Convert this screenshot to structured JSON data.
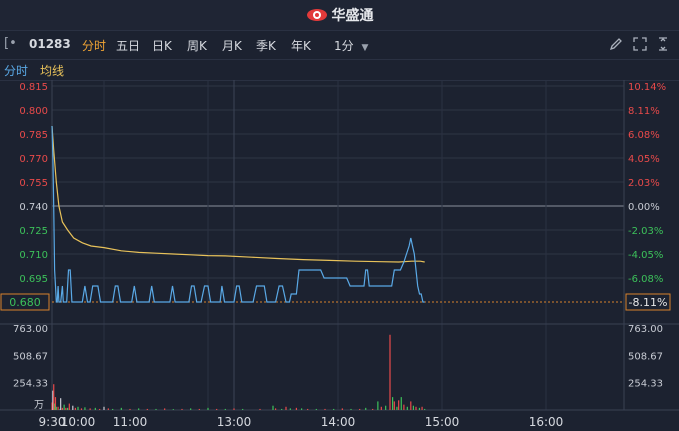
{
  "app": {
    "brand": "华盛通"
  },
  "toolbar": {
    "stock_code": "01283",
    "tabs": [
      {
        "label": "分时",
        "active": true
      },
      {
        "label": "五日",
        "active": false
      },
      {
        "label": "日K",
        "active": false
      },
      {
        "label": "周K",
        "active": false
      },
      {
        "label": "月K",
        "active": false
      },
      {
        "label": "季K",
        "active": false
      },
      {
        "label": "年K",
        "active": false
      }
    ],
    "interval": "1分"
  },
  "legend": {
    "price": "分时",
    "avg": "均线"
  },
  "colors": {
    "price_line": "#5aa9e6",
    "avg_line": "#e8c25a",
    "up": "#e84a4a",
    "down": "#3cc15a",
    "neutral": "#c8ccd4",
    "background": "#1c2230"
  },
  "chart_data": [
    {
      "type": "line",
      "name": "intraday",
      "y_left_labels": [
        "0.815",
        "0.800",
        "0.785",
        "0.770",
        "0.755",
        "0.740",
        "0.725",
        "0.710",
        "0.695"
      ],
      "y_right_labels": [
        "10.14%",
        "8.11%",
        "6.08%",
        "4.05%",
        "2.03%",
        "0.00%",
        "-2.03%",
        "-4.05%",
        "-6.08%"
      ],
      "ylim": [
        0.68,
        0.815
      ],
      "prev_close": 0.74,
      "current_price": "0.680",
      "current_change": "-8.11%",
      "x_labels": [
        "9:30",
        "10:00",
        "11:00",
        "13:00",
        "14:00",
        "15:00",
        "16:00"
      ],
      "series": [
        {
          "name": "分时",
          "values": [
            [
              0,
              0.79
            ],
            [
              1,
              0.77
            ],
            [
              2,
              0.74
            ],
            [
              3,
              0.7
            ],
            [
              4,
              0.69
            ],
            [
              5,
              0.68
            ],
            [
              6,
              0.68
            ],
            [
              7,
              0.69
            ],
            [
              8,
              0.68
            ],
            [
              10,
              0.68
            ],
            [
              12,
              0.69
            ],
            [
              13,
              0.68
            ],
            [
              15,
              0.68
            ],
            [
              17,
              0.68
            ],
            [
              19,
              0.7
            ],
            [
              21,
              0.7
            ],
            [
              23,
              0.68
            ],
            [
              25,
              0.68
            ],
            [
              30,
              0.68
            ],
            [
              35,
              0.68
            ],
            [
              38,
              0.69
            ],
            [
              41,
              0.68
            ],
            [
              44,
              0.68
            ],
            [
              47,
              0.69
            ],
            [
              50,
              0.69
            ],
            [
              53,
              0.69
            ],
            [
              56,
              0.68
            ],
            [
              60,
              0.68
            ],
            [
              65,
              0.68
            ],
            [
              70,
              0.68
            ],
            [
              73,
              0.69
            ],
            [
              76,
              0.69
            ],
            [
              79,
              0.68
            ],
            [
              85,
              0.68
            ],
            [
              92,
              0.68
            ],
            [
              95,
              0.69
            ],
            [
              98,
              0.68
            ],
            [
              105,
              0.68
            ],
            [
              112,
              0.68
            ],
            [
              115,
              0.69
            ],
            [
              118,
              0.68
            ],
            [
              125,
              0.68
            ],
            [
              130,
              0.68
            ],
            [
              136,
              0.68
            ],
            [
              139,
              0.69
            ],
            [
              142,
              0.68
            ],
            [
              150,
              0.68
            ],
            [
              158,
              0.68
            ],
            [
              161,
              0.69
            ],
            [
              164,
              0.69
            ],
            [
              167,
              0.68
            ],
            [
              172,
              0.68
            ],
            [
              176,
              0.69
            ],
            [
              180,
              0.69
            ],
            [
              183,
              0.68
            ],
            [
              188,
              0.68
            ],
            [
              194,
              0.68
            ],
            [
              196,
              0.69
            ],
            [
              199,
              0.68
            ],
            [
              205,
              0.68
            ],
            [
              210,
              0.68
            ],
            [
              213,
              0.69
            ],
            [
              216,
              0.69
            ],
            [
              219,
              0.68
            ],
            [
              225,
              0.68
            ],
            [
              232,
              0.68
            ],
            [
              236,
              0.69
            ],
            [
              240,
              0.69
            ],
            [
              245,
              0.69
            ],
            [
              248,
              0.68
            ],
            [
              252,
              0.68
            ],
            [
              258,
              0.68
            ],
            [
              262,
              0.69
            ],
            [
              266,
              0.69
            ],
            [
              270,
              0.68
            ],
            [
              274,
              0.68
            ],
            [
              276,
              0.685
            ],
            [
              279,
              0.685
            ],
            [
              282,
              0.685
            ],
            [
              285,
              0.7
            ],
            [
              290,
              0.7
            ],
            [
              295,
              0.7
            ],
            [
              300,
              0.7
            ],
            [
              305,
              0.7
            ],
            [
              310,
              0.7
            ],
            [
              314,
              0.695
            ],
            [
              320,
              0.695
            ],
            [
              325,
              0.695
            ],
            [
              330,
              0.695
            ],
            [
              335,
              0.695
            ],
            [
              340,
              0.695
            ],
            [
              344,
              0.69
            ],
            [
              348,
              0.69
            ],
            [
              352,
              0.69
            ],
            [
              356,
              0.69
            ],
            [
              360,
              0.69
            ],
            [
              362,
              0.7
            ],
            [
              364,
              0.7
            ],
            [
              366,
              0.69
            ],
            [
              372,
              0.69
            ],
            [
              378,
              0.69
            ],
            [
              384,
              0.69
            ],
            [
              388,
              0.69
            ],
            [
              392,
              0.69
            ],
            [
              395,
              0.7
            ],
            [
              398,
              0.7
            ],
            [
              402,
              0.7
            ],
            [
              406,
              0.705
            ],
            [
              409,
              0.71
            ],
            [
              412,
              0.715
            ],
            [
              414,
              0.72
            ],
            [
              416,
              0.715
            ],
            [
              418,
              0.71
            ],
            [
              420,
              0.7
            ],
            [
              422,
              0.69
            ],
            [
              424,
              0.685
            ],
            [
              426,
              0.685
            ],
            [
              428,
              0.68
            ],
            [
              430,
              0.68
            ]
          ]
        },
        {
          "name": "均线",
          "values": [
            [
              0,
              0.79
            ],
            [
              2,
              0.775
            ],
            [
              5,
              0.755
            ],
            [
              8,
              0.74
            ],
            [
              12,
              0.73
            ],
            [
              18,
              0.725
            ],
            [
              25,
              0.72
            ],
            [
              35,
              0.717
            ],
            [
              45,
              0.715
            ],
            [
              60,
              0.714
            ],
            [
              80,
              0.712
            ],
            [
              100,
              0.711
            ],
            [
              120,
              0.7105
            ],
            [
              140,
              0.71
            ],
            [
              160,
              0.7095
            ],
            [
              180,
              0.709
            ],
            [
              200,
              0.7088
            ],
            [
              230,
              0.708
            ],
            [
              260,
              0.7072
            ],
            [
              290,
              0.7065
            ],
            [
              320,
              0.706
            ],
            [
              350,
              0.7055
            ],
            [
              380,
              0.7052
            ],
            [
              400,
              0.705
            ],
            [
              415,
              0.7055
            ],
            [
              425,
              0.7055
            ],
            [
              430,
              0.705
            ]
          ]
        }
      ]
    },
    {
      "type": "bar",
      "name": "volume",
      "y_labels": [
        "763.00",
        "508.67",
        "254.33"
      ],
      "ylim": [
        0,
        763
      ],
      "unit": "万",
      "values": [
        [
          0,
          70
        ],
        [
          1,
          180
        ],
        [
          2,
          240
        ],
        [
          3,
          60
        ],
        [
          4,
          120
        ],
        [
          5,
          30
        ],
        [
          7,
          30
        ],
        [
          9,
          10
        ],
        [
          10,
          110
        ],
        [
          12,
          20
        ],
        [
          14,
          50
        ],
        [
          16,
          20
        ],
        [
          18,
          20
        ],
        [
          20,
          60
        ],
        [
          24,
          40
        ],
        [
          27,
          20
        ],
        [
          30,
          30
        ],
        [
          34,
          15
        ],
        [
          38,
          25
        ],
        [
          44,
          15
        ],
        [
          50,
          20
        ],
        [
          55,
          10
        ],
        [
          60,
          30
        ],
        [
          65,
          15
        ],
        [
          70,
          10
        ],
        [
          80,
          20
        ],
        [
          90,
          10
        ],
        [
          100,
          15
        ],
        [
          110,
          10
        ],
        [
          120,
          10
        ],
        [
          130,
          15
        ],
        [
          140,
          8
        ],
        [
          150,
          10
        ],
        [
          160,
          15
        ],
        [
          170,
          10
        ],
        [
          180,
          20
        ],
        [
          190,
          10
        ],
        [
          200,
          10
        ],
        [
          210,
          15
        ],
        [
          220,
          10
        ],
        [
          240,
          10
        ],
        [
          255,
          40
        ],
        [
          258,
          15
        ],
        [
          265,
          10
        ],
        [
          270,
          30
        ],
        [
          275,
          15
        ],
        [
          282,
          20
        ],
        [
          288,
          15
        ],
        [
          295,
          10
        ],
        [
          305,
          10
        ],
        [
          315,
          10
        ],
        [
          325,
          10
        ],
        [
          335,
          15
        ],
        [
          345,
          10
        ],
        [
          355,
          10
        ],
        [
          362,
          20
        ],
        [
          370,
          10
        ],
        [
          376,
          80
        ],
        [
          380,
          30
        ],
        [
          385,
          40
        ],
        [
          390,
          700
        ],
        [
          393,
          120
        ],
        [
          395,
          80
        ],
        [
          398,
          30
        ],
        [
          400,
          90
        ],
        [
          403,
          120
        ],
        [
          406,
          50
        ],
        [
          410,
          30
        ],
        [
          414,
          80
        ],
        [
          417,
          40
        ],
        [
          420,
          30
        ],
        [
          424,
          20
        ],
        [
          427,
          30
        ],
        [
          430,
          10
        ]
      ],
      "up_indices": [
        0,
        2,
        4,
        7,
        12,
        16,
        20,
        27,
        34,
        44,
        55,
        65,
        90,
        110,
        130,
        150,
        170,
        190,
        210,
        240,
        258,
        270,
        282,
        295,
        315,
        335,
        355,
        370,
        380,
        390,
        395,
        400,
        406,
        414,
        420,
        427
      ],
      "neutral_indices": [
        1,
        10,
        24,
        60
      ]
    }
  ]
}
